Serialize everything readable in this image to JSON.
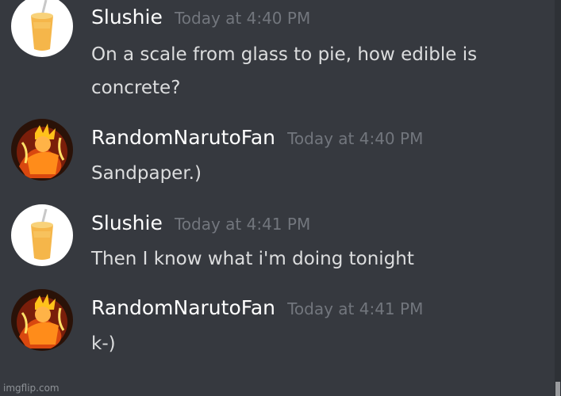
{
  "messages": [
    {
      "username": "Slushie",
      "timestamp": "Today at 4:40 PM",
      "text": "On a scale from glass to pie, how edible is\nconcrete?",
      "avatar_icon": "slushie-cup-icon"
    },
    {
      "username": "RandomNarutoFan",
      "timestamp": "Today at 4:40 PM",
      "text": "Sandpaper.)",
      "avatar_icon": "naruto-avatar-icon"
    },
    {
      "username": "Slushie",
      "timestamp": "Today at 4:41 PM",
      "text": "Then I know what i'm doing tonight",
      "avatar_icon": "slushie-cup-icon"
    },
    {
      "username": "RandomNarutoFan",
      "timestamp": "Today at 4:41 PM",
      "text": "k-)",
      "avatar_icon": "naruto-avatar-icon"
    }
  ],
  "watermark": "imgflip.com",
  "colors": {
    "background": "#36393f",
    "username": "#ffffff",
    "timestamp": "#72767d",
    "message_text": "#dcddde"
  }
}
